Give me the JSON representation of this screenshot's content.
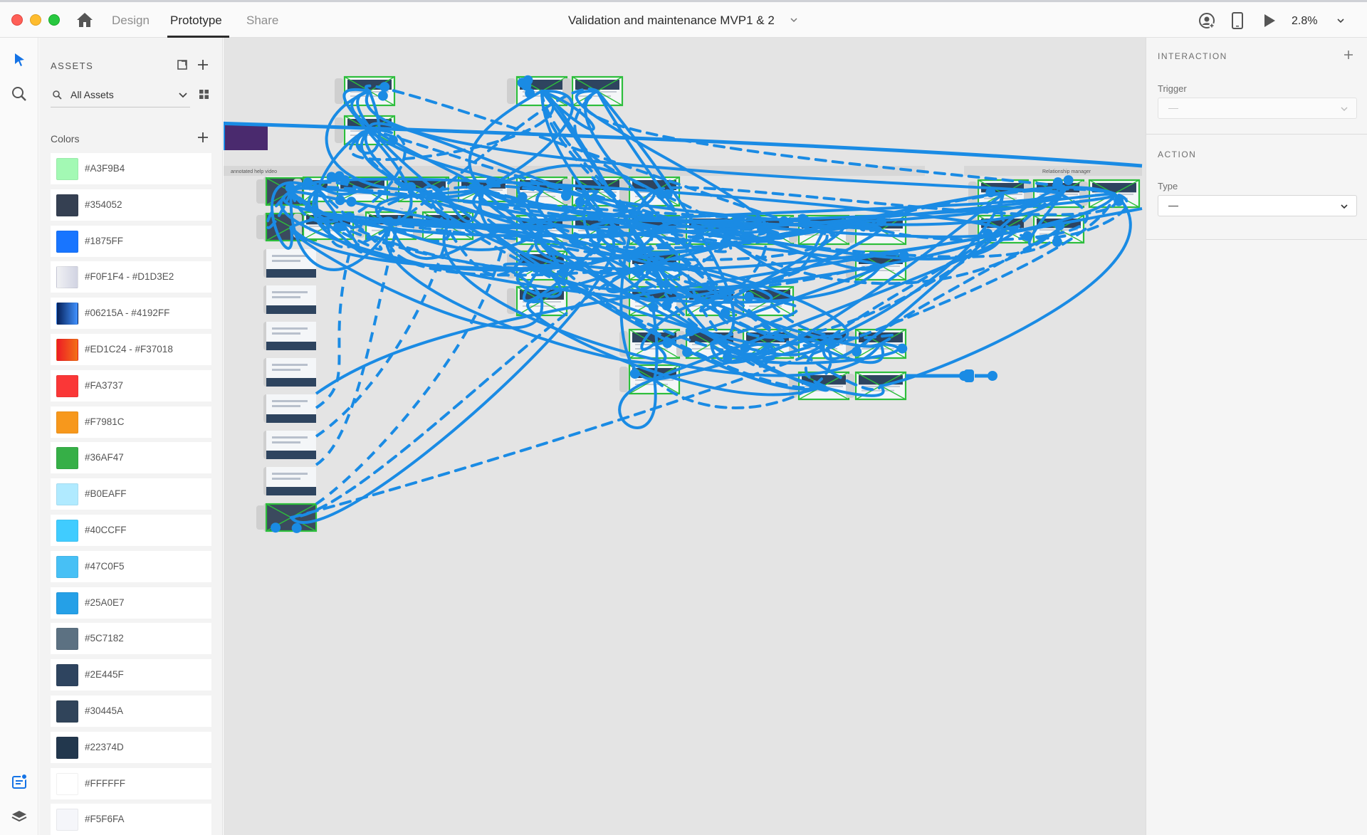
{
  "titlebar": {
    "tabs": [
      {
        "label": "Design",
        "active": false
      },
      {
        "label": "Prototype",
        "active": true
      },
      {
        "label": "Share",
        "active": false
      }
    ],
    "document_title": "Validation and maintenance MVP1 & 2",
    "zoom": "2.8%"
  },
  "assets": {
    "title": "ASSETS",
    "search_value": "All Assets",
    "colors_heading": "Colors",
    "colors": [
      {
        "label": "#A3F9B4",
        "color": "#A3F9B4"
      },
      {
        "label": "#354052",
        "color": "#354052"
      },
      {
        "label": "#1875FF",
        "color": "#1875FF"
      },
      {
        "label": "#F0F1F4 - #D1D3E2",
        "color": "linear-gradient(90deg,#F0F1F4,#D1D3E2)"
      },
      {
        "label": "#06215A - #4192FF",
        "color": "linear-gradient(90deg,#06215A,#4192FF)"
      },
      {
        "label": "#ED1C24 - #F37018",
        "color": "linear-gradient(90deg,#ED1C24,#F37018)"
      },
      {
        "label": "#FA3737",
        "color": "#FA3737"
      },
      {
        "label": "#F7981C",
        "color": "#F7981C"
      },
      {
        "label": "#36AF47",
        "color": "#36AF47"
      },
      {
        "label": "#B0EAFF",
        "color": "#B0EAFF"
      },
      {
        "label": "#40CCFF",
        "color": "#40CCFF"
      },
      {
        "label": "#47C0F5",
        "color": "#47C0F5"
      },
      {
        "label": "#25A0E7",
        "color": "#25A0E7"
      },
      {
        "label": "#5C7182",
        "color": "#5C7182"
      },
      {
        "label": "#2E445F",
        "color": "#2E445F"
      },
      {
        "label": "#30445A",
        "color": "#30445A"
      },
      {
        "label": "#22374D",
        "color": "#22374D"
      },
      {
        "label": "#FFFFFF",
        "color": "#FFFFFF"
      },
      {
        "label": "#F5F6FA",
        "color": "#F5F6FA"
      }
    ]
  },
  "interaction": {
    "section_title": "INTERACTION",
    "trigger_label": "Trigger",
    "trigger_value": "—",
    "action_title": "ACTION",
    "type_label": "Type",
    "type_value": "—"
  },
  "canvas": {
    "artboard_labels": [
      "annotated help video",
      "Relationship manager"
    ],
    "wire_color": "#1A8BE4",
    "frame_color": "#2DBE3C"
  }
}
